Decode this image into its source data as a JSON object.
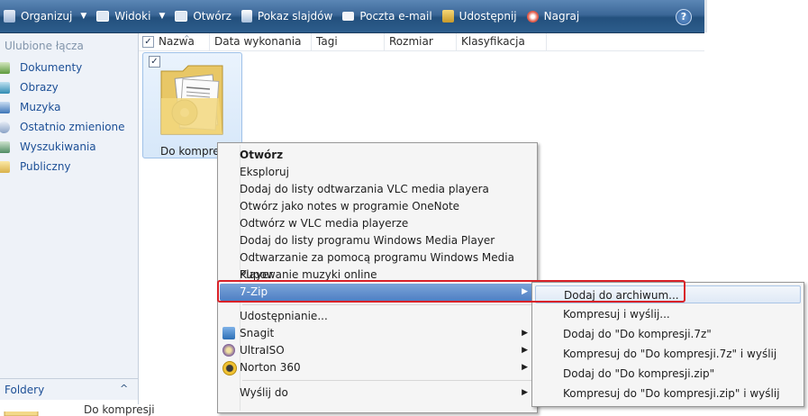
{
  "toolbar": {
    "organize": "Organizuj",
    "views": "Widoki",
    "open": "Otwórz",
    "slideshow": "Pokaz slajdów",
    "email": "Poczta e-mail",
    "share": "Udostępnij",
    "burn": "Nagraj",
    "help": "?"
  },
  "nav": {
    "favorites_header": "Ulubione łącza",
    "items": [
      "Dokumenty",
      "Obrazy",
      "Muzyka",
      "Ostatnio zmienione",
      "Wyszukiwania",
      "Publiczny"
    ],
    "folders_label": "Foldery",
    "folders_chevron": "^"
  },
  "columns": [
    "Nazwa",
    "Data wykonania",
    "Tagi",
    "Rozmiar",
    "Klasyfikacja"
  ],
  "file_item": {
    "label": "Do kompres",
    "bottom_label": "Do kompresji"
  },
  "context_menu": {
    "items": [
      "Otwórz",
      "Eksploruj",
      "Dodaj do listy odtwarzania VLC media playera",
      "Otwórz jako notes w programie OneNote",
      "Odtwórz w VLC media playerze",
      "Dodaj do listy programu Windows Media Player",
      "Odtwarzanie za pomocą programu Windows Media Player",
      "Kupowanie muzyki online",
      "7-Zip",
      "Udostępnianie...",
      "Snagit",
      "UltraISO",
      "Norton 360",
      "Wyślij do"
    ]
  },
  "submenu": {
    "items": [
      "Dodaj do archiwum...",
      "Kompresuj i wyślij...",
      "Dodaj do \"Do kompresji.7z\"",
      "Kompresuj do \"Do kompresji.7z\" i wyślij",
      "Dodaj do \"Do kompresji.zip\"",
      "Kompresuj do \"Do kompresji.zip\" i wyślij"
    ]
  },
  "colors": {
    "toolbar": "#2d5d8c",
    "selection": "#4f80c4",
    "highlight_box": "#d92128",
    "nav_text": "#1c4f96"
  }
}
